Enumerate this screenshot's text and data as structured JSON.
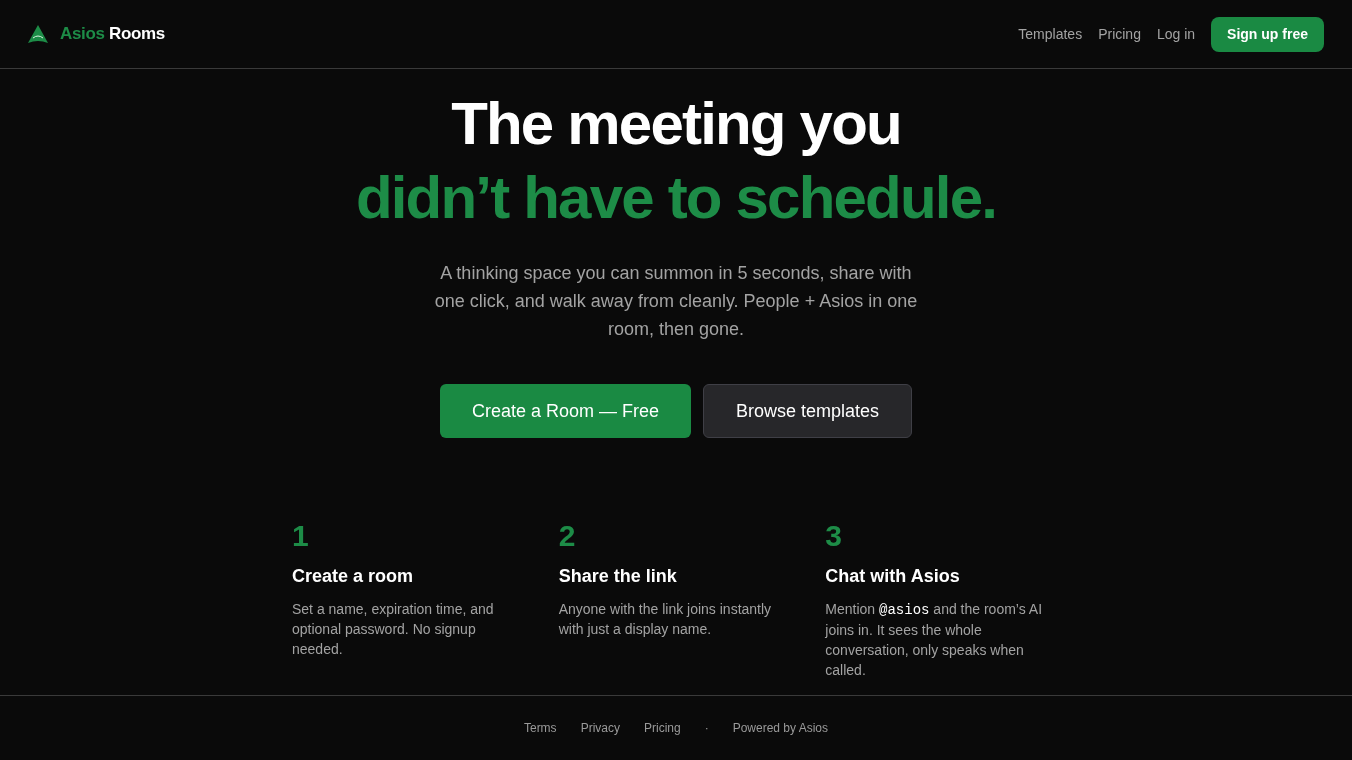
{
  "header": {
    "brand": {
      "first": "Asios",
      "second": "Rooms"
    },
    "nav_links": [
      "Templates",
      "Pricing",
      "Log in"
    ],
    "cta": "Sign up free"
  },
  "hero": {
    "title_lines": [
      {
        "text": "The meeting you",
        "kind": "plain"
      },
      {
        "text": "didn’t have to schedule.",
        "kind": "accent"
      }
    ],
    "subtitle": "A thinking space you can summon in 5 seconds, share with one click, and walk away from cleanly. People + Asios in one room, then gone.",
    "buttons": [
      {
        "label": "Create a Room — Free",
        "kind": "primary"
      },
      {
        "label": "Browse templates",
        "kind": "secondary"
      }
    ]
  },
  "steps": [
    {
      "number": "1",
      "title": "Create a room",
      "description": [
        {
          "kind": "text",
          "text": "Set a name, expiration time, and optional password. No signup needed."
        }
      ]
    },
    {
      "number": "2",
      "title": "Share the link",
      "description": [
        {
          "kind": "text",
          "text": "Anyone with the link joins instantly with just a display name."
        }
      ]
    },
    {
      "number": "3",
      "title": "Chat with Asios",
      "description": [
        {
          "kind": "text",
          "text": "Mention "
        },
        {
          "kind": "code",
          "text": "@asios"
        },
        {
          "kind": "text",
          "text": " and the room’s AI joins in. It sees the whole conversation, only speaks when called."
        }
      ]
    }
  ],
  "footer": {
    "links": [
      "Terms",
      "Privacy",
      "Pricing"
    ],
    "separator": "·",
    "credit": "Powered by Asios"
  }
}
